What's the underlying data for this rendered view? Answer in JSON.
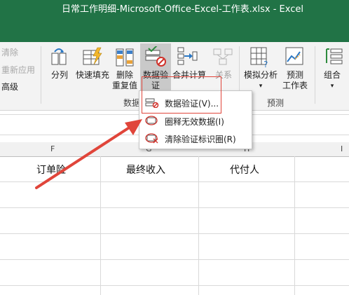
{
  "window": {
    "title": "日常工作明细-Microsoft-Office-Excel-工作表.xlsx  -  Excel"
  },
  "ribbon": {
    "left_commands": {
      "clear": "清除",
      "reapply": "重新应用",
      "advanced": "高级"
    },
    "buttons": {
      "split": "分列",
      "flash_fill": "快速填充",
      "remove_duplicates_1": "删除",
      "remove_duplicates_2": "重复值",
      "data_validation_1": "数据验",
      "data_validation_2": "证",
      "consolidate": "合并计算",
      "relationships": "关系",
      "what_if": "模拟分析",
      "forecast_1": "预测",
      "forecast_2": "工作表",
      "group": "组合"
    },
    "groups": {
      "data_tools": "数据",
      "forecast": "预测"
    }
  },
  "dropdown": {
    "items": [
      {
        "label": "数据验证(V)...",
        "icon": "data-validation-icon"
      },
      {
        "label": "圈释无效数据(I)",
        "icon": "circle-invalid-icon"
      },
      {
        "label": "清除验证标识圈(R)",
        "icon": "clear-circles-icon"
      }
    ]
  },
  "sheet": {
    "columns": [
      "F",
      "G",
      "H",
      "I"
    ],
    "header_row": [
      "订单险",
      "最终收入",
      "代付人"
    ]
  },
  "colors": {
    "title_bar": "#217346",
    "highlight": "#e0453a",
    "arrow": "#e0453a"
  }
}
